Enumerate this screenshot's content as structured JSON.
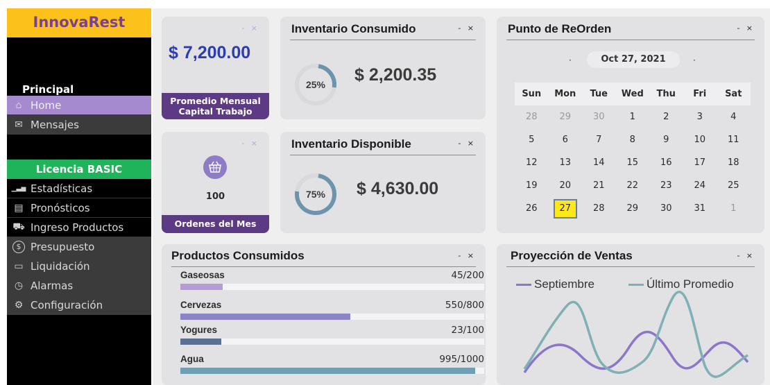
{
  "app": {
    "brand": "InnovaRest"
  },
  "sidebar": {
    "principal_title": "Principal",
    "principal_items": [
      {
        "label": "Home",
        "icon": "home-icon",
        "active": true
      },
      {
        "label": "Mensajes",
        "icon": "mail-icon"
      }
    ],
    "license": "Licencia BASIC",
    "items": [
      {
        "label": "Estadísticas",
        "icon": "bar-chart-icon"
      },
      {
        "label": "Pronósticos",
        "icon": "document-icon"
      },
      {
        "label": "Ingreso Productos",
        "icon": "cart-add-icon"
      },
      {
        "label": "Presupuesto",
        "icon": "dollar-icon"
      },
      {
        "label": "Liquidación",
        "icon": "monitor-icon"
      },
      {
        "label": "Alarmas",
        "icon": "clock-icon"
      },
      {
        "label": "Configuración",
        "icon": "settings-icon"
      }
    ]
  },
  "capital": {
    "amount": "$ 7,200.00",
    "label_line1": "Promedio Mensual",
    "label_line2": "Capital Trabajo"
  },
  "orders": {
    "count": "100",
    "label": "Ordenes del Mes",
    "icon": "basket-icon"
  },
  "inv_consumed": {
    "title": "Inventario Consumido",
    "percent_label": "25%",
    "percent": 25,
    "amount": "$ 2,200.35"
  },
  "inv_available": {
    "title": "Inventario Disponible",
    "percent_label": "75%",
    "percent": 75,
    "amount": "$ 4,630.00"
  },
  "calendar": {
    "title": "Punto de ReOrden",
    "date": "Oct 27, 2021",
    "headers": [
      "Sun",
      "Mon",
      "Tue",
      "Wed",
      "Thu",
      "Fri",
      "Sat"
    ],
    "weeks": [
      [
        "28",
        "29",
        "30",
        "1",
        "2",
        "3",
        "4"
      ],
      [
        "5",
        "6",
        "7",
        "8",
        "9",
        "10",
        "11"
      ],
      [
        "12",
        "13",
        "14",
        "15",
        "16",
        "17",
        "18"
      ],
      [
        "19",
        "20",
        "21",
        "22",
        "23",
        "24",
        "25"
      ],
      [
        "26",
        "27",
        "28",
        "29",
        "30",
        "31",
        "1"
      ]
    ],
    "today": "27"
  },
  "products": {
    "title": "Productos Consumidos",
    "items": [
      {
        "name": "Gaseosas",
        "value": "45/200",
        "ratio": 0.14,
        "color": "#b79ad8"
      },
      {
        "name": "Cervezas",
        "value": "550/800",
        "ratio": 0.56,
        "color": "#8a84c6"
      },
      {
        "name": "Yogures",
        "value": "23/100",
        "ratio": 0.135,
        "color": "#5a6f93"
      },
      {
        "name": "Agua",
        "value": "995/1000",
        "ratio": 0.97,
        "color": "#6f9fb1"
      }
    ]
  },
  "sales": {
    "title": "Proyección de Ventas",
    "legend": [
      {
        "name": "Septiembre",
        "color": "#8b76c9"
      },
      {
        "name": "Último Promedio",
        "color": "#7fb0b5"
      }
    ]
  },
  "colors": {
    "accent": "#5d3a84",
    "money": "#2c3db4",
    "ring": "#6d94ad"
  }
}
